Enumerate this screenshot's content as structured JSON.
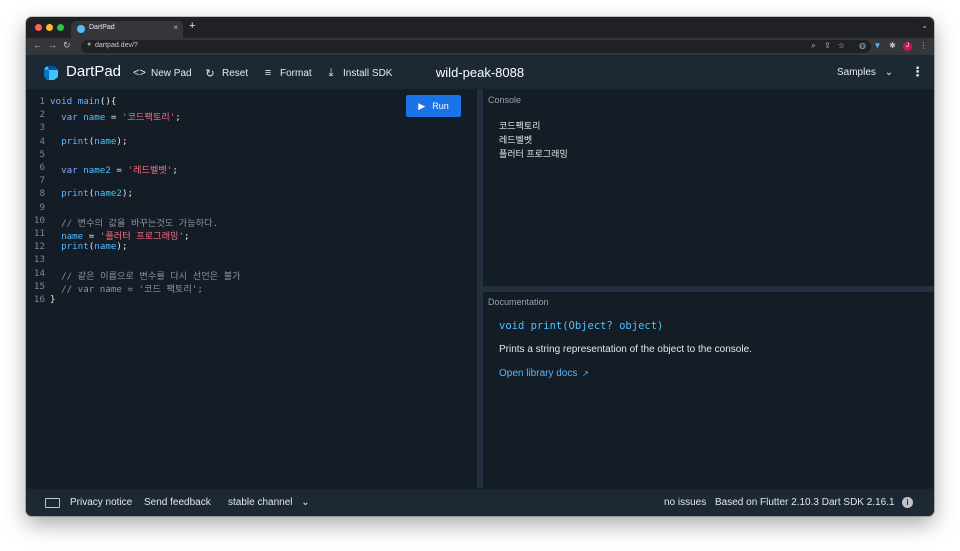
{
  "browser": {
    "tab_title": "DartPad",
    "tab_close": "×",
    "new_tab": "+",
    "tab_menu": "⌄",
    "url": "dartpad.dev/?",
    "nav": {
      "back": "←",
      "forward": "→",
      "reload": "↻"
    },
    "avatar_letter": "J",
    "window_colors": {
      "close": "#ff5f57",
      "minimize": "#febc2e",
      "maximize": "#28c840"
    }
  },
  "header": {
    "brand": "DartPad",
    "buttons": [
      {
        "icon": "code-icon",
        "glyph": "<>",
        "label": "New Pad"
      },
      {
        "icon": "reset-icon",
        "glyph": "↻",
        "label": "Reset"
      },
      {
        "icon": "format-icon",
        "glyph": "≡",
        "label": "Format"
      },
      {
        "icon": "download-icon",
        "glyph": "⤓",
        "label": "Install SDK"
      }
    ],
    "pad_name": "wild-peak-8088",
    "samples_label": "Samples",
    "samples_chevron": "⌄",
    "menu_glyph": "⋮"
  },
  "editor": {
    "run_label": "Run",
    "lines": [
      {
        "n": "1",
        "tokens": [
          {
            "t": "void ",
            "c": "kw"
          },
          {
            "t": "main",
            "c": "fn"
          },
          {
            "t": "(){",
            "c": ""
          }
        ]
      },
      {
        "n": "2",
        "tokens": [
          {
            "t": "  var ",
            "c": "kw"
          },
          {
            "t": "name",
            "c": "id"
          },
          {
            "t": " = ",
            "c": ""
          },
          {
            "t": "'코드팩토리'",
            "c": "str"
          },
          {
            "t": ";",
            "c": ""
          }
        ]
      },
      {
        "n": "3",
        "tokens": []
      },
      {
        "n": "4",
        "tokens": [
          {
            "t": "  print",
            "c": "fn"
          },
          {
            "t": "(",
            "c": ""
          },
          {
            "t": "name",
            "c": "id"
          },
          {
            "t": ");",
            "c": ""
          }
        ]
      },
      {
        "n": "5",
        "tokens": []
      },
      {
        "n": "6",
        "tokens": [
          {
            "t": "  var ",
            "c": "kw"
          },
          {
            "t": "name2",
            "c": "id"
          },
          {
            "t": " = ",
            "c": ""
          },
          {
            "t": "'레드벨벳'",
            "c": "str"
          },
          {
            "t": ";",
            "c": ""
          }
        ]
      },
      {
        "n": "7",
        "tokens": []
      },
      {
        "n": "8",
        "tokens": [
          {
            "t": "  print",
            "c": "fn"
          },
          {
            "t": "(",
            "c": ""
          },
          {
            "t": "name2",
            "c": "id"
          },
          {
            "t": ");",
            "c": ""
          }
        ]
      },
      {
        "n": "9",
        "tokens": []
      },
      {
        "n": "10",
        "tokens": [
          {
            "t": "  // 변수의 값을 바꾸는것도 가능하다.",
            "c": "cm"
          }
        ]
      },
      {
        "n": "11",
        "tokens": [
          {
            "t": "  name",
            "c": "id"
          },
          {
            "t": " = ",
            "c": ""
          },
          {
            "t": "'플러터 프로그래밍'",
            "c": "str"
          },
          {
            "t": ";",
            "c": ""
          }
        ]
      },
      {
        "n": "12",
        "tokens": [
          {
            "t": "  print",
            "c": "fn"
          },
          {
            "t": "(",
            "c": ""
          },
          {
            "t": "name",
            "c": "id"
          },
          {
            "t": ");",
            "c": ""
          }
        ]
      },
      {
        "n": "13",
        "tokens": []
      },
      {
        "n": "14",
        "tokens": [
          {
            "t": "  // 같은 이름으로 변수를 다시 선언은 불가",
            "c": "cm"
          }
        ]
      },
      {
        "n": "15",
        "tokens": [
          {
            "t": "  // var name = '코드 팩토리';",
            "c": "cm"
          }
        ]
      },
      {
        "n": "16",
        "tokens": [
          {
            "t": "}",
            "c": ""
          }
        ]
      }
    ]
  },
  "console": {
    "label": "Console",
    "output": [
      "코드팩토리",
      "레드벨벳",
      "플러터 프로그래밍"
    ]
  },
  "docs": {
    "label": "Documentation",
    "signature": "void print(Object? object)",
    "description": "Prints a string representation of the object to the console.",
    "link": "Open library docs",
    "link_icon": "↗"
  },
  "footer": {
    "privacy": "Privacy notice",
    "feedback": "Send feedback",
    "channel": "stable channel",
    "channel_chevron": "⌄",
    "issues": "no issues",
    "version": "Based on Flutter 2.10.3 Dart SDK 2.16.1",
    "info_glyph": "i"
  }
}
